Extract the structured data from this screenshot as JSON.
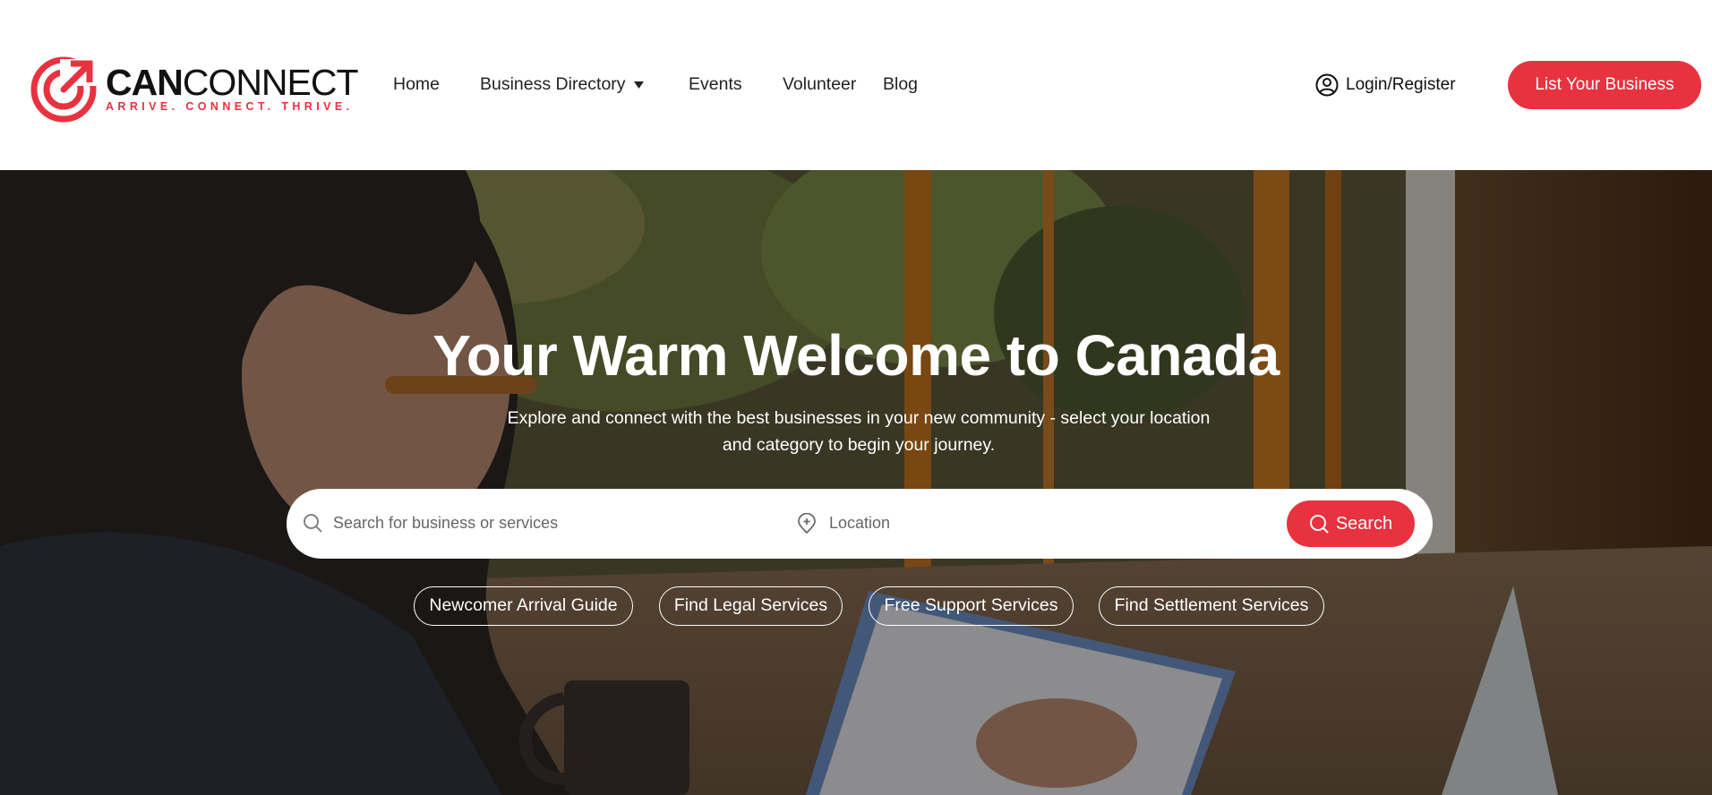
{
  "brand": {
    "name_bold": "CAN",
    "name_light": "CONNECT",
    "tagline": "ARRIVE. CONNECT. THRIVE.",
    "accent_color": "#e8323f"
  },
  "nav": {
    "items": [
      {
        "label": "Home"
      },
      {
        "label": "Business Directory",
        "icon": "caret-down-icon"
      },
      {
        "label": "Events"
      },
      {
        "label": "Volunteer"
      },
      {
        "label": "Blog"
      }
    ]
  },
  "header": {
    "login_label": "Login/Register",
    "login_icon": "user-circle-icon",
    "cta_label": "List Your Business"
  },
  "hero": {
    "title": "Your Warm Welcome to Canada",
    "subtitle": "Explore and connect with the best businesses in your new community - select your location and category to begin your journey.",
    "search": {
      "placeholder": "Search for business or services",
      "value": "",
      "icon": "search-icon"
    },
    "location": {
      "placeholder": "Location",
      "value": "",
      "icon": "location-pin-icon"
    },
    "search_button_label": "Search",
    "quick_links": [
      {
        "label": "Newcomer Arrival Guide"
      },
      {
        "label": "Find Legal Services"
      },
      {
        "label": "Free Support Services"
      },
      {
        "label": "Find Settlement Services"
      }
    ]
  }
}
